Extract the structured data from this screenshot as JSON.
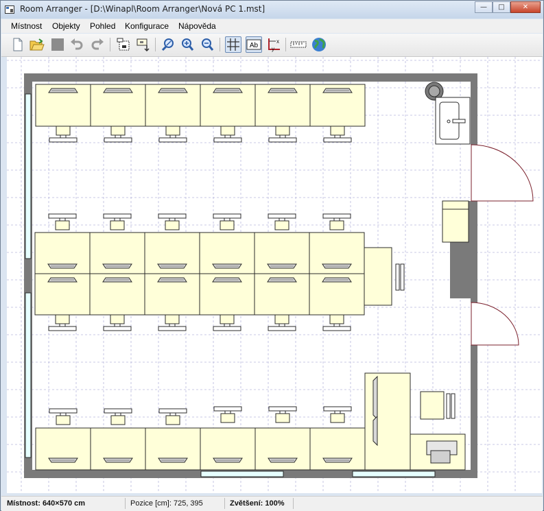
{
  "window": {
    "title": "Room Arranger - [D:\\Winapl\\Room Arranger\\Nová PC 1.mst]",
    "minimize_glyph": "—",
    "maximize_glyph": "□",
    "close_glyph": "✕"
  },
  "menu": {
    "items": [
      "Místnost",
      "Objekty",
      "Pohled",
      "Konfigurace",
      "Nápověda"
    ]
  },
  "toolbar": {
    "buttons": [
      {
        "icon": "new-file-icon"
      },
      {
        "icon": "open-folder-icon"
      },
      {
        "icon": "save-icon"
      },
      {
        "icon": "undo-icon"
      },
      {
        "icon": "redo-icon"
      },
      {
        "icon": "select-objects-icon"
      },
      {
        "icon": "add-object-icon"
      },
      {
        "icon": "zoom-icon"
      },
      {
        "icon": "zoom-in-icon"
      },
      {
        "icon": "zoom-out-icon"
      },
      {
        "icon": "grid-icon",
        "pressed": true
      },
      {
        "icon": "labels-icon",
        "pressed": true,
        "text": "Ab"
      },
      {
        "icon": "axes-icon",
        "text": "y x"
      },
      {
        "icon": "ruler-icon"
      },
      {
        "icon": "globe-icon"
      }
    ]
  },
  "status": {
    "room_label": "Místnost: 640×570 cm",
    "position_label": "Pozice [cm]: 725, 395",
    "zoom_label": "Zvětšení: 100%"
  },
  "colors": {
    "wall": "#7a7a7a",
    "furniture_fill": "#ffffd9",
    "grid": "#b8b8dc",
    "window": "#e6ffff",
    "door": "#7a1f2b"
  }
}
